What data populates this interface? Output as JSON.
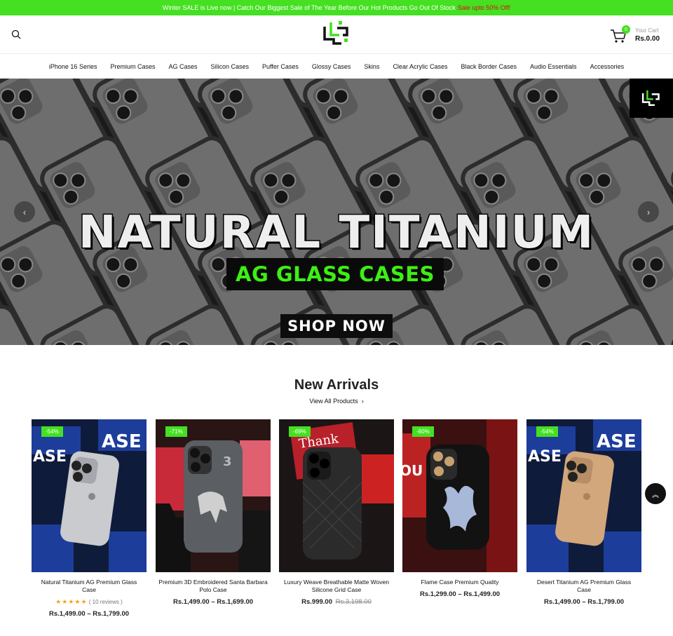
{
  "announcement": {
    "text": "Winter SALE is Live now | Catch Our Biggest Sale of The Year Before Our Hot Products Go Out Of Stock",
    "highlight": "Sale upto 50% Off!"
  },
  "header": {
    "cart_label": "Your Cart",
    "cart_total": "Rs.0.00",
    "cart_count": "0"
  },
  "nav": {
    "items": [
      {
        "label": "iPhone 16 Series"
      },
      {
        "label": "Premium Cases"
      },
      {
        "label": "AG Cases"
      },
      {
        "label": "Silicon Cases"
      },
      {
        "label": "Puffer Cases"
      },
      {
        "label": "Glossy Cases"
      },
      {
        "label": "Skins"
      },
      {
        "label": "Clear Acrylic Cases"
      },
      {
        "label": "Black Border Cases"
      },
      {
        "label": "Audio Essentials"
      },
      {
        "label": "Accessories"
      }
    ]
  },
  "hero": {
    "title": "NATURAL TITANIUM",
    "subtitle": "AG GLASS CASES",
    "cta": "SHOP NOW"
  },
  "section": {
    "title": "New Arrivals",
    "view_all": "View All Products"
  },
  "products": [
    {
      "badge": "-54%",
      "name": "Natural Titanium AG Premium Glass Case",
      "stars": "★★★★★",
      "reviews": "( 10 reviews )",
      "price": "Rs.1,499.00 – Rs.1,799.00",
      "old_price": ""
    },
    {
      "badge": "-71%",
      "name": "Premium 3D Embroidered Santa Barbara Polo Case",
      "stars": "",
      "reviews": "",
      "price": "Rs.1,499.00 – Rs.1,699.00",
      "old_price": ""
    },
    {
      "badge": "-69%",
      "name": "Luxury Weave Breathable Matte Woven Silicone Grid Case",
      "stars": "",
      "reviews": "",
      "price": "Rs.999.00",
      "old_price": "Rs.3,198.00"
    },
    {
      "badge": "-60%",
      "name": "Flame Case Premium Quality",
      "stars": "",
      "reviews": "",
      "price": "Rs.1,299.00 – Rs.1,499.00",
      "old_price": ""
    },
    {
      "badge": "-54%",
      "name": "Desert Titanium AG Premium Glass Case",
      "stars": "",
      "reviews": "",
      "price": "Rs.1,499.00 – Rs.1,799.00",
      "old_price": ""
    }
  ],
  "colors": {
    "accent": "#44e021",
    "sale_text": "#d8121a",
    "hero_green": "#3cf013",
    "star": "#f4a21a"
  },
  "icons": {
    "search": "search-icon",
    "cart": "cart-icon",
    "arrow_left": "chevron-left-icon",
    "arrow_right": "chevron-right-icon",
    "scroll_top": "double-chevron-up-icon"
  }
}
